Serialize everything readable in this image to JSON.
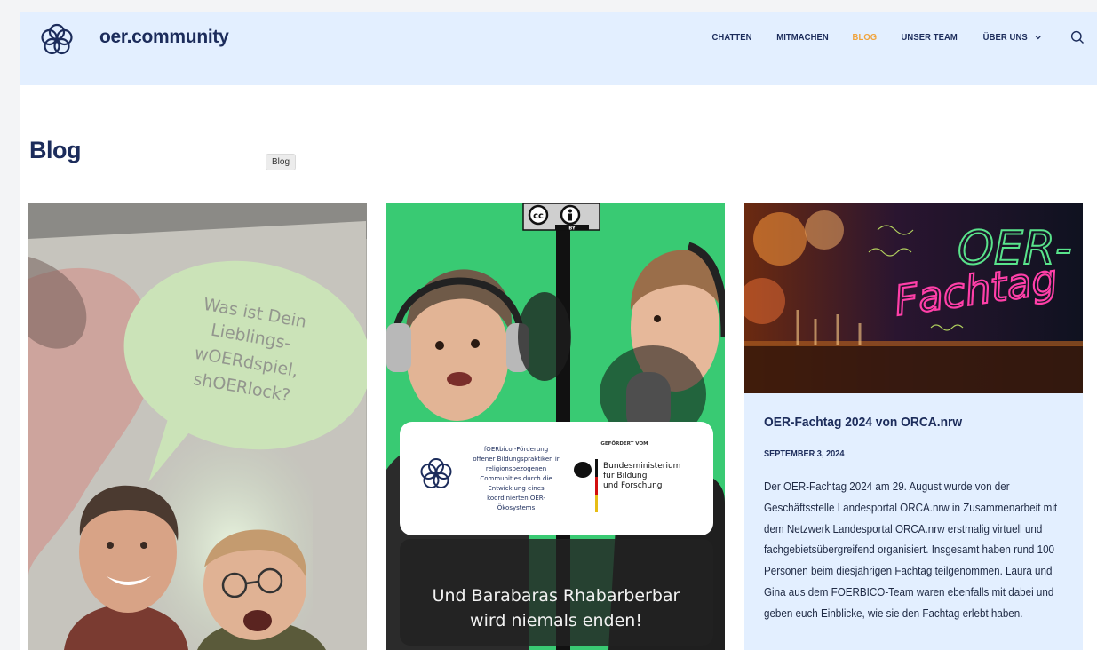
{
  "site": {
    "name": "oer.community",
    "brand_color": "#1c2c5b",
    "header_bg": "#e3efff",
    "accent_color": "#f0a33c"
  },
  "nav": {
    "items": [
      {
        "label": "CHATTEN",
        "active": false
      },
      {
        "label": "MITMACHEN",
        "active": false
      },
      {
        "label": "BLOG",
        "active": true
      },
      {
        "label": "UNSER TEAM",
        "active": false
      },
      {
        "label": "ÜBER UNS",
        "active": false,
        "has_dropdown": true
      }
    ],
    "search_icon": "search-icon",
    "dropdown_icon": "chevron-down-icon"
  },
  "page": {
    "title": "Blog",
    "tooltip": "Blog"
  },
  "posts": [
    {
      "image": {
        "bubble_text": [
          "Was ist Dein",
          "Lieblings-",
          "wOERdspiel,",
          "shOERlock?"
        ]
      }
    },
    {
      "image": {
        "license_badge": [
          "cc",
          "BY"
        ],
        "funding_text": [
          "fOERbico -Förderung",
          "offener Bildungspraktiken ir",
          "religionsbezogenen",
          "Communities durch die",
          "Entwicklung eines",
          "koordinierten OER-",
          "Ökosystems"
        ],
        "funder_label": "GEFÖRDERT VOM",
        "ministry": [
          "Bundesministerium",
          "für Bildung",
          "und Forschung"
        ],
        "caption": [
          "Und Barabaras Rhabarberbar",
          "wird niemals enden!"
        ]
      }
    },
    {
      "image": {
        "neon_text": [
          "OER-",
          "Fachtag"
        ]
      },
      "title": "OER-Fachtag 2024 von ORCA.nrw",
      "date": "SEPTEMBER 3, 2024",
      "excerpt": "Der OER-Fachtag 2024 am 29. August wurde von der Geschäftsstelle Landesportal ORCA.nrw in Zusammenarbeit mit dem Netzwerk Landesportal ORCA.nrw erstmalig virtuell und fachgebietsübergreifend organisiert. Insgesamt haben rund 100 Personen beim diesjährigen Fachtag teilgenommen. Laura und Gina aus dem FOERBICO-Team waren ebenfalls mit dabei und geben euch Einblicke, wie sie den Fachtag erlebt haben."
    }
  ]
}
